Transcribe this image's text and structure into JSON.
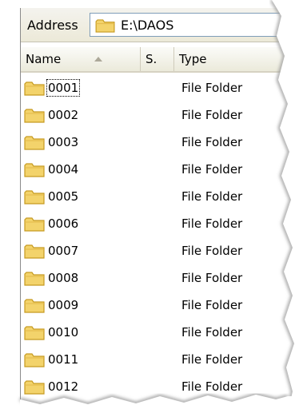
{
  "address": {
    "label": "Address",
    "path": "E:\\DAOS"
  },
  "icons": {
    "folder": "folder-icon",
    "sort": "sort-ascending-icon"
  },
  "columns": {
    "name": "Name",
    "size": "S.",
    "type": "Type"
  },
  "rows": [
    {
      "name": "0001",
      "type": "File Folder"
    },
    {
      "name": "0002",
      "type": "File Folder"
    },
    {
      "name": "0003",
      "type": "File Folder"
    },
    {
      "name": "0004",
      "type": "File Folder"
    },
    {
      "name": "0005",
      "type": "File Folder"
    },
    {
      "name": "0006",
      "type": "File Folder"
    },
    {
      "name": "0007",
      "type": "File Folder"
    },
    {
      "name": "0008",
      "type": "File Folder"
    },
    {
      "name": "0009",
      "type": "File Folder"
    },
    {
      "name": "0010",
      "type": "File Folder"
    },
    {
      "name": "0011",
      "type": "File Folder"
    },
    {
      "name": "0012",
      "type": "File Folder"
    }
  ],
  "colors": {
    "folder_fill": "#f3d36b",
    "folder_stroke": "#c69a20",
    "header_border": "#d6d2c2"
  }
}
